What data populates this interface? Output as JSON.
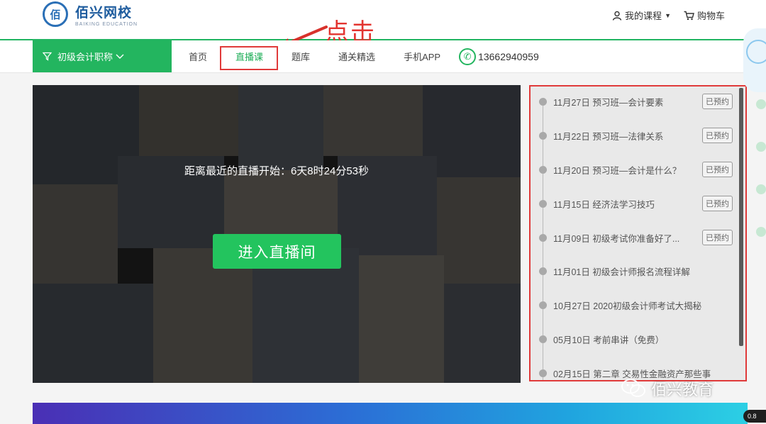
{
  "header": {
    "logo_cn": "佰兴网校",
    "logo_en": "BAIKING EDUCATION",
    "logo_badge": "佰",
    "my_courses": "我的课程",
    "cart": "购物车"
  },
  "annotation": {
    "text": "点击",
    "color": "#e3342f"
  },
  "nav": {
    "category": "初级会计职称",
    "items": [
      "首页",
      "直播课",
      "题库",
      "通关精选",
      "手机APP"
    ],
    "active_index": 1,
    "phone": "13662940959",
    "accent": "#23b55f"
  },
  "video": {
    "countdown": "距离最近的直播开始：6天8时24分53秒",
    "enter_button": "进入直播间"
  },
  "schedule": [
    {
      "label": "11月27日 预习班—会计要素",
      "badge": "已预约"
    },
    {
      "label": "11月22日 预习班—法律关系",
      "badge": "已预约"
    },
    {
      "label": "11月20日 预习班—会计是什么？",
      "badge": "已预约"
    },
    {
      "label": "11月15日 经济法学习技巧",
      "badge": "已预约"
    },
    {
      "label": "11月09日 初级考试你准备好了...",
      "badge": "已预约"
    },
    {
      "label": "11月01日 初级会计师报名流程详解",
      "badge": ""
    },
    {
      "label": "10月27日 2020初级会计师考试大揭秘",
      "badge": ""
    },
    {
      "label": "05月10日 考前串讲（免费）",
      "badge": ""
    },
    {
      "label": "02月15日 第二章 交易性金融资产那些事",
      "badge": ""
    }
  ],
  "watermark": "佰兴教育",
  "speed_indicator": "0.8"
}
